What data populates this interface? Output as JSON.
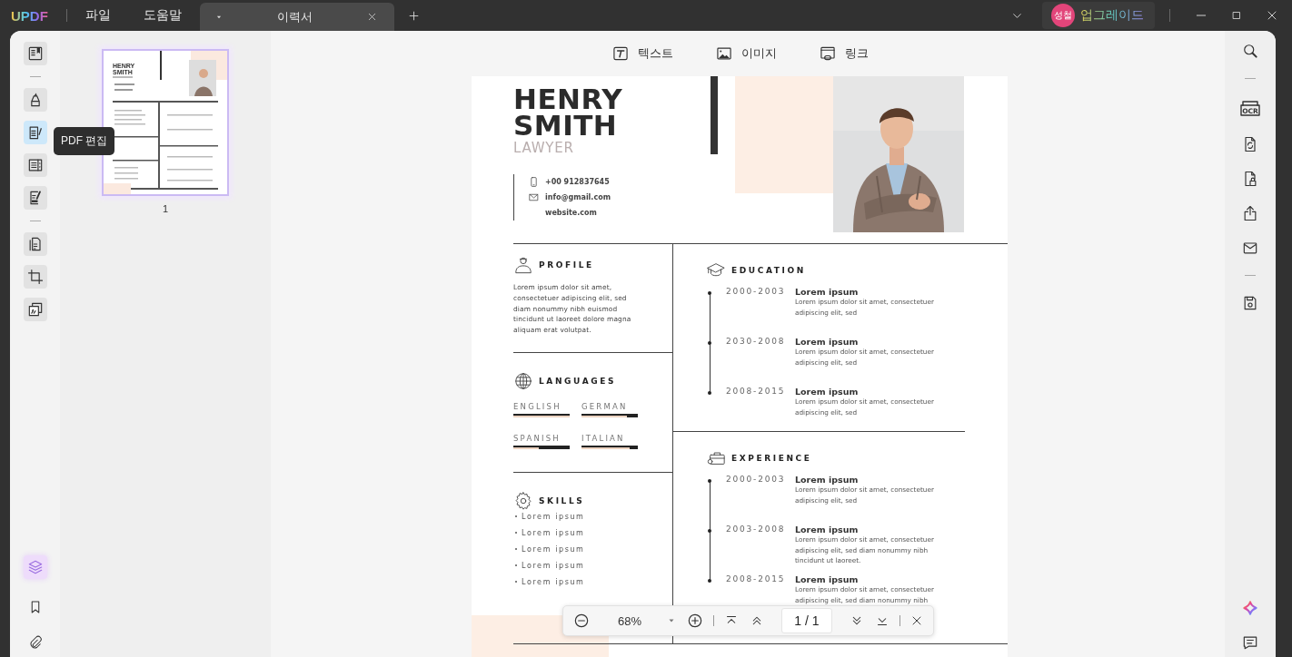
{
  "app": {
    "logo": "UPDF",
    "menus": [
      "파일",
      "도움말"
    ]
  },
  "tabs": [
    {
      "title": "이력서",
      "selected": true
    }
  ],
  "upgrade": {
    "avatar": "성철",
    "label": "업그레이드"
  },
  "left_tools": [
    {
      "selected": false
    },
    {
      "selected": false
    },
    {
      "selected": true
    },
    {
      "selected": false
    },
    {
      "selected": false
    },
    {
      "selected": false
    },
    {
      "selected": false
    },
    {
      "selected": false
    }
  ],
  "tooltip": "PDF 편집",
  "thumbnails": [
    {
      "title_lines": [
        "HENRY",
        "SMITH"
      ],
      "page": "1",
      "selected": true
    }
  ],
  "edit_toolbar": [
    {
      "label": "텍스트"
    },
    {
      "label": "이미지"
    },
    {
      "label": "링크"
    }
  ],
  "right_rail": {
    "ocr_label": "OCR"
  },
  "document": {
    "name_lines": [
      "HENRY",
      "SMITH"
    ],
    "role": "LAWYER",
    "contacts": [
      {
        "kind": "phone",
        "text": "+00 912837645"
      },
      {
        "kind": "email",
        "text": "info@gmail.com"
      },
      {
        "kind": "web",
        "text": "website.com"
      }
    ],
    "profile": {
      "heading": "PROFILE",
      "text": "Lorem ipsum dolor sit amet, consectetuer adipiscing elit, sed diam nonummy nibh euismod tincidunt ut laoreet dolore magna aliquam erat volutpat."
    },
    "languages": {
      "heading": "LANGUAGES",
      "items": [
        {
          "name": "ENGLISH",
          "level": 1
        },
        {
          "name": "GERMAN",
          "level": 0.8
        },
        {
          "name": "SPANISH",
          "level": 0.45
        },
        {
          "name": "ITALIAN",
          "level": 0.85
        }
      ]
    },
    "skills": {
      "heading": "SKILLS",
      "items": [
        "Lorem ipsum",
        "Lorem ipsum",
        "Lorem ipsum",
        "Lorem ipsum",
        "Lorem ipsum"
      ]
    },
    "education": {
      "heading": "EDUCATION",
      "entries": [
        {
          "years": "2000-2003",
          "title": "Lorem ipsum",
          "text": "Lorem ipsum dolor sit amet, consectetuer adipiscing elit, sed"
        },
        {
          "years": "2030-2008",
          "title": "Lorem ipsum",
          "text": "Lorem ipsum dolor sit amet, consectetuer adipiscing elit, sed"
        },
        {
          "years": "2008-2015",
          "title": "Lorem ipsum",
          "text": "Lorem ipsum dolor sit amet, consectetuer adipiscing elit, sed"
        }
      ]
    },
    "experience": {
      "heading": "EXPERIENCE",
      "entries": [
        {
          "years": "2000-2003",
          "title": "Lorem ipsum",
          "text": "Lorem ipsum dolor sit amet, consectetuer adipiscing elit, sed"
        },
        {
          "years": "2003-2008",
          "title": "Lorem ipsum",
          "text": "Lorem ipsum dolor sit amet, consectetuer adipiscing elit, sed diam nonummy nibh tincidunt ut laoreet."
        },
        {
          "years": "2008-2015",
          "title": "Lorem ipsum",
          "text": "Lorem ipsum dolor sit amet, consectetuer adipiscing elit, sed diam nonummy nibh"
        }
      ]
    }
  },
  "zoom_bar": {
    "zoom": "68%",
    "page_indicator": "1 / 1"
  }
}
